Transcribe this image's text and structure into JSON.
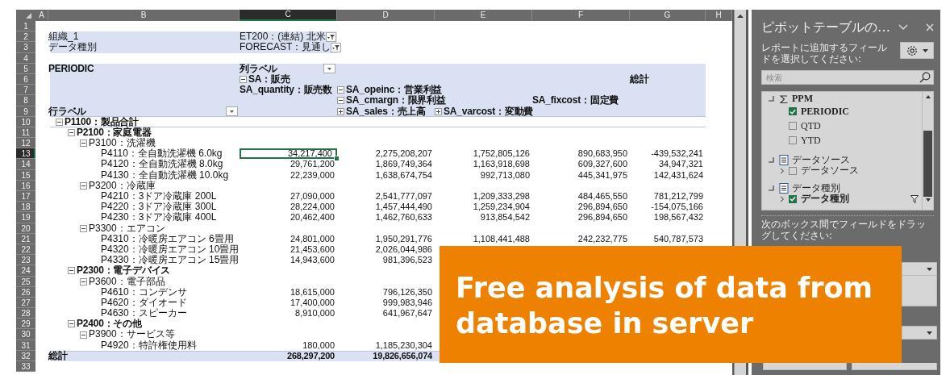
{
  "sheet": {
    "column_headers": [
      {
        "label": "A",
        "selected": false
      },
      {
        "label": "B",
        "selected": false
      },
      {
        "label": "C",
        "selected": true
      },
      {
        "label": "D",
        "selected": false
      },
      {
        "label": "E",
        "selected": false
      },
      {
        "label": "F",
        "selected": false
      },
      {
        "label": "G",
        "selected": false
      },
      {
        "label": "H",
        "selected": false
      }
    ],
    "row_numbers": [
      {
        "label": "1",
        "selected": false
      },
      {
        "label": "2",
        "selected": false
      },
      {
        "label": "3",
        "selected": false
      },
      {
        "label": "4",
        "selected": false
      },
      {
        "label": "5",
        "selected": false
      },
      {
        "label": "6",
        "selected": false
      },
      {
        "label": "7",
        "selected": false
      },
      {
        "label": "8",
        "selected": false
      },
      {
        "label": "9",
        "selected": false
      },
      {
        "label": "10",
        "selected": false
      },
      {
        "label": "11",
        "selected": false
      },
      {
        "label": "12",
        "selected": false
      },
      {
        "label": "13",
        "selected": true
      },
      {
        "label": "14",
        "selected": false
      },
      {
        "label": "15",
        "selected": false
      },
      {
        "label": "16",
        "selected": false
      },
      {
        "label": "17",
        "selected": false
      },
      {
        "label": "18",
        "selected": false
      },
      {
        "label": "19",
        "selected": false
      },
      {
        "label": "20",
        "selected": false
      },
      {
        "label": "21",
        "selected": false
      },
      {
        "label": "22",
        "selected": false
      },
      {
        "label": "23",
        "selected": false
      },
      {
        "label": "24",
        "selected": false
      },
      {
        "label": "25",
        "selected": false
      },
      {
        "label": "26",
        "selected": false
      },
      {
        "label": "27",
        "selected": false
      },
      {
        "label": "28",
        "selected": false
      },
      {
        "label": "29",
        "selected": false
      },
      {
        "label": "30",
        "selected": false
      },
      {
        "label": "31",
        "selected": false
      },
      {
        "label": "32",
        "selected": false
      },
      {
        "label": "33",
        "selected": false
      }
    ]
  },
  "pivot": {
    "filters": [
      {
        "label": "組織_1",
        "value": "ET200：(連結) 北米"
      },
      {
        "label": "データ種別",
        "value": "FORECAST：見通し"
      }
    ],
    "header_rows": [
      {
        "B": {
          "text": "PERIODIC"
        },
        "C": {
          "text": "列ラベル",
          "dropdown": true
        }
      },
      {
        "C": {
          "text": "SA：販売",
          "expanded": true
        },
        "G": {
          "text": "総計"
        }
      },
      {
        "C": {
          "text": "SA_quantity：販売数"
        },
        "D": {
          "text": "SA_opeinc：営業利益",
          "expanded": true
        }
      },
      {
        "D": {
          "text": "SA_cmargn：限界利益",
          "expanded": true
        },
        "F": {
          "text": "SA_fixcost：固定費"
        }
      },
      {
        "B": {
          "text": "行ラベル",
          "dropdown": true
        },
        "D": {
          "text": "SA_sales：売上高",
          "expanded": false
        },
        "E": {
          "text": "SA_varcost：変動費",
          "expanded": false
        }
      }
    ],
    "rows": [
      {
        "label": "P1100：製品合計",
        "expanded": true,
        "selected": false,
        "children": [
          {
            "label": "P2100：家庭電器",
            "expanded": true,
            "selected": false,
            "children": [
              {
                "label": "P3100：洗濯機",
                "expanded": true,
                "selected": false,
                "children": [
                  {
                    "label": "P4110：全自動洗濯機 6.0kg",
                    "selected": true,
                    "values": [
                      "34,217,400",
                      "2,275,208,207",
                      "1,752,805,126",
                      "890,683,950",
                      "-439,532,241"
                    ]
                  },
                  {
                    "label": "P4120：全自動洗濯機 8.0kg",
                    "selected": false,
                    "values": [
                      "29,761,200",
                      "1,869,749,364",
                      "1,163,918,698",
                      "609,327,600",
                      "34,947,321"
                    ]
                  },
                  {
                    "label": "P4130：全自動洗濯機 10.0kg",
                    "selected": false,
                    "values": [
                      "22,239,000",
                      "1,638,674,754",
                      "992,713,080",
                      "445,341,975",
                      "142,431,624"
                    ]
                  }
                ]
              },
              {
                "label": "P3200：冷蔵庫",
                "expanded": true,
                "selected": false,
                "children": [
                  {
                    "label": "P4210：3ドア冷蔵庫 200L",
                    "selected": false,
                    "values": [
                      "27,090,000",
                      "2,541,777,097",
                      "1,209,333,298",
                      "484,465,550",
                      "781,212,799"
                    ]
                  },
                  {
                    "label": "P4220：3ドア冷蔵庫 300L",
                    "selected": false,
                    "values": [
                      "28,224,000",
                      "1,457,444,490",
                      "1,259,234,904",
                      "296,894,650",
                      "-154,075,166"
                    ]
                  },
                  {
                    "label": "P4230：3ドア冷蔵庫 400L",
                    "selected": false,
                    "values": [
                      "20,462,400",
                      "1,462,760,633",
                      "913,854,542",
                      "296,894,650",
                      "198,567,432"
                    ]
                  }
                ]
              },
              {
                "label": "P3300：エアコン",
                "expanded": true,
                "selected": false,
                "children": [
                  {
                    "label": "P4310：冷暖房エアコン 6畳用",
                    "selected": false,
                    "values": [
                      "24,801,000",
                      "1,950,291,776",
                      "1,108,441,488",
                      "242,232,775",
                      "540,787,573"
                    ]
                  },
                  {
                    "label": "P4320：冷暖房エアコン 10畳用",
                    "selected": false,
                    "values": [
                      "21,453,600",
                      "2,026,044,986"
                    ]
                  },
                  {
                    "label": "P4330：冷暖房エアコン 15畳用",
                    "selected": false,
                    "values": [
                      "14,943,600",
                      "981,396,523"
                    ]
                  }
                ]
              }
            ]
          },
          {
            "label": "P2300：電子デバイス",
            "expanded": true,
            "selected": false,
            "children": [
              {
                "label": "P3600：電子部品",
                "expanded": true,
                "selected": false,
                "children": [
                  {
                    "label": "P4610：コンデンサ",
                    "selected": false,
                    "values": [
                      "18,615,000",
                      "796,126,350"
                    ]
                  },
                  {
                    "label": "P4620：ダイオード",
                    "selected": false,
                    "values": [
                      "17,400,000",
                      "999,983,946"
                    ]
                  },
                  {
                    "label": "P4630：スピーカー",
                    "selected": false,
                    "values": [
                      "8,910,000",
                      "641,967,647"
                    ]
                  }
                ]
              }
            ]
          },
          {
            "label": "P2400：その他",
            "expanded": true,
            "selected": false,
            "children": [
              {
                "label": "P3900：サービス等",
                "expanded": true,
                "selected": false,
                "children": [
                  {
                    "label": "P4920：特許権使用料",
                    "selected": false,
                    "values": [
                      "180,000",
                      "1,185,230,304"
                    ]
                  }
                ]
              }
            ]
          }
        ]
      }
    ],
    "grand_total": {
      "label": "総計",
      "values": [
        "268,297,200",
        "19,826,656,074"
      ]
    }
  },
  "field_pane": {
    "title": "ピボットテーブルの…",
    "instruction": "レポートに追加するフィールドを選択してください:",
    "search": {
      "placeholder": "検索"
    },
    "fields": [
      {
        "label": "PPM",
        "kind": "measure",
        "children": [
          {
            "label": "PERIODIC",
            "checked": true
          },
          {
            "label": "QTD",
            "checked": false
          },
          {
            "label": "YTD",
            "checked": false
          }
        ]
      },
      {
        "label": "データソース",
        "kind": "table",
        "children": [
          {
            "label": "データソース",
            "checked": false
          }
        ]
      },
      {
        "label": "データ種別",
        "kind": "table",
        "children": [
          {
            "label": "データ種別",
            "checked": true,
            "filtered": true
          }
        ]
      }
    ],
    "areas_hint": "次のボックス間でフィールドをドラッグしてください:"
  },
  "callout": {
    "text": "Free analysis of data from database in server"
  }
}
